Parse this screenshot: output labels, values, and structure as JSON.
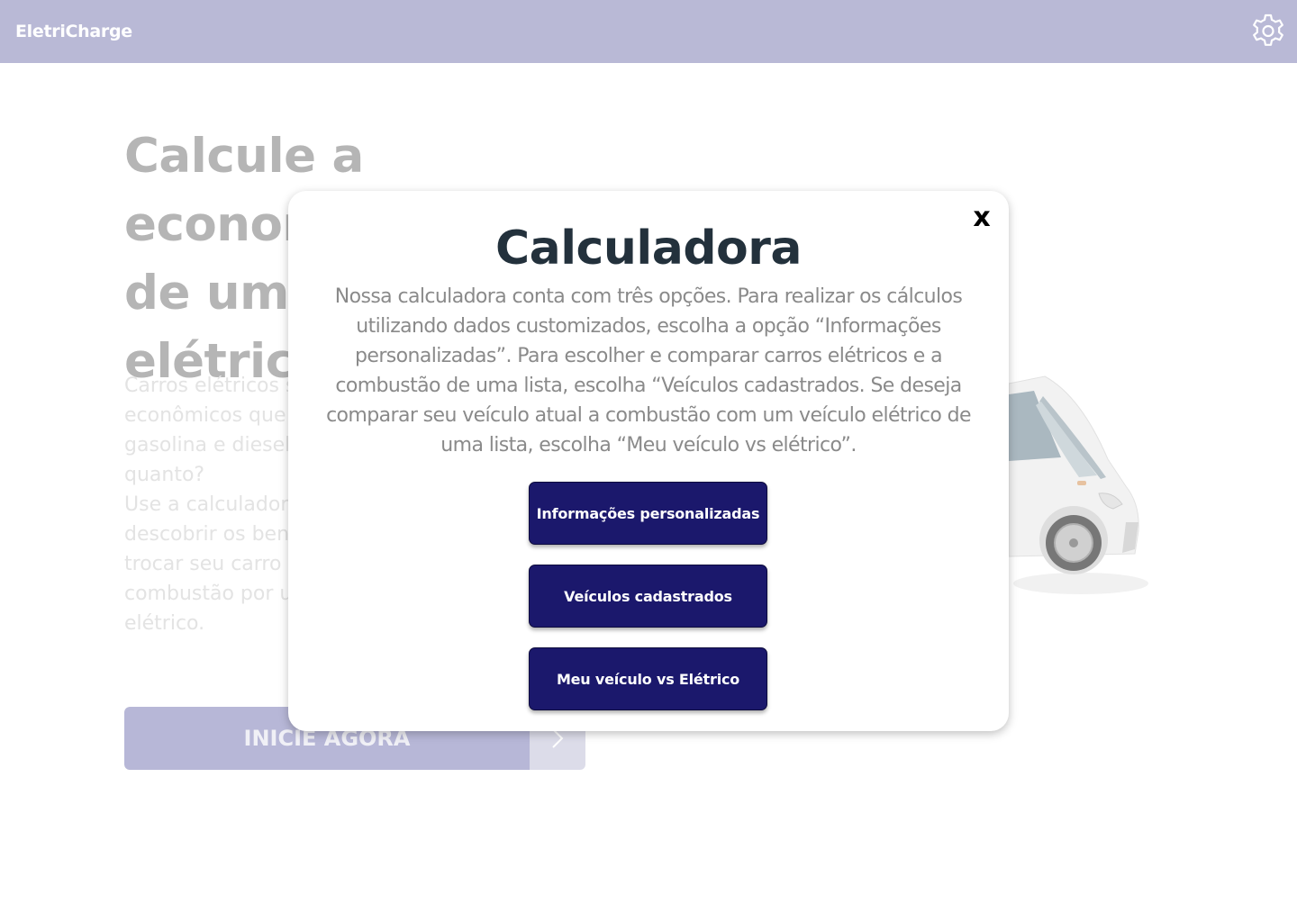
{
  "header": {
    "logo_text": "EletriCharge",
    "settings_icon": "gear-icon",
    "bar_color": "#b9b9d6"
  },
  "hero": {
    "title_lines": [
      "Calcule a economia",
      "de um carro",
      "elétrico"
    ],
    "paragraph1": "Carros elétricos são mais econômicos que os a gasolina e diesel, mas quanto?",
    "paragraph2": "Use a calculadora para descobrir os benefícios de trocar seu carro a combustão por um elétrico.",
    "cta_label": "INICIE AGORA",
    "cta_icon": "chevron-right-icon"
  },
  "modal": {
    "close_label": "x",
    "title": "Calculadora",
    "description": "Nossa calculadora conta com três opções. Para realizar os cálculos utilizando dados customizados, escolha a opção “Informações personalizadas”. Para escolher  e comparar carros elétricos e a combustão de uma lista, escolha “Veículos cadastrados. Se deseja comparar seu veículo atual a combustão com um veículo elétrico de uma lista, escolha “Meu veículo vs elétrico”.",
    "buttons": [
      {
        "label": "Informações personalizadas"
      },
      {
        "label": "Veículos cadastrados"
      },
      {
        "label": "Meu veículo vs Elétrico"
      }
    ],
    "button_color": "#1b186c"
  }
}
